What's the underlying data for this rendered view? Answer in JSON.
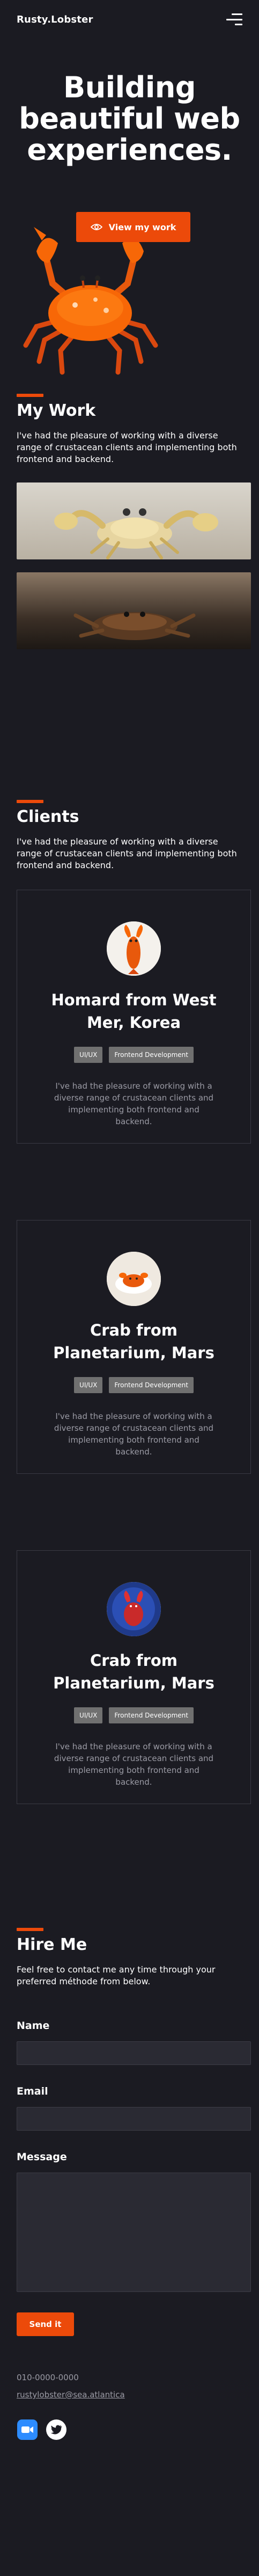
{
  "nav": {
    "brand": "Rusty.Lobster",
    "menu_icon": "hamburger-menu-icon"
  },
  "hero": {
    "title": "Building beautiful web experiences.",
    "cta_label": "View my work",
    "cta_icon": "eye-icon"
  },
  "work": {
    "title": "My Work",
    "text": "I've had the pleasure of working with a diverse range of crustacean clients and implementing both frontend and backend."
  },
  "clients": {
    "title": "Clients",
    "text": "I've had the pleasure of working with a diverse range of crustacean clients and implementing both frontend and backend.",
    "cards": [
      {
        "name": "Homard from West Mer, Korea",
        "tags": [
          "UI/UX",
          "Frontend Development"
        ],
        "text": "I've had the pleasure of working with a diverse range of crustacean clients and implementing both frontend and backend."
      },
      {
        "name": "Crab from Planetarium, Mars",
        "tags": [
          "UI/UX",
          "Frontend Development"
        ],
        "text": "I've had the pleasure of working with a diverse range of crustacean clients and implementing both frontend and backend."
      },
      {
        "name": "Crab from Planetarium, Mars",
        "tags": [
          "UI/UX",
          "Frontend Development"
        ],
        "text": "I've had the pleasure of working with a diverse range of crustacean clients and implementing both frontend and backend."
      }
    ]
  },
  "hire": {
    "title": "Hire Me",
    "text": "Feel free to contact me any time through your preferred méthode from below.",
    "name_label": "Name",
    "email_label": "Email",
    "message_label": "Message",
    "send_label": "Send it",
    "phone": "010-0000-0000",
    "email": "rustylobster@sea.atlantica"
  },
  "socials": [
    {
      "icon": "zoom-icon",
      "color": "#2d8cff"
    },
    {
      "icon": "twitter-icon",
      "color": "#ffffff"
    }
  ],
  "colors": {
    "background": "#1b1b22",
    "accent": "#ec4a0a",
    "tag": "#707070",
    "muted_text": "#9b9ba5"
  }
}
